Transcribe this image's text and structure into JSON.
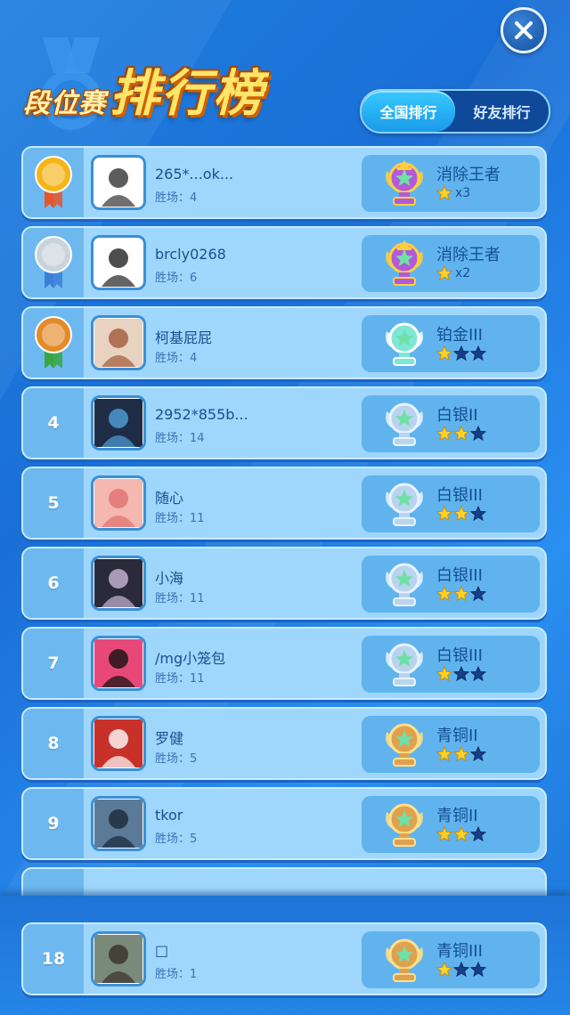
{
  "header": {
    "title_small": "段位赛",
    "title_big": "排行榜"
  },
  "tabs": [
    {
      "label": "全国排行",
      "active": true
    },
    {
      "label": "好友排行",
      "active": false
    }
  ],
  "wins_label": "胜场：",
  "rows": [
    {
      "rank": "1",
      "medal": "gold",
      "name": "265*...ok...",
      "wins": "4",
      "tier": "消除王者",
      "badge": "king",
      "star_count": "x3",
      "stars_filled": 1,
      "stars_total": 1
    },
    {
      "rank": "2",
      "medal": "silver",
      "name": "brcly0268",
      "wins": "6",
      "tier": "消除王者",
      "badge": "king",
      "star_count": "x2",
      "stars_filled": 1,
      "stars_total": 1
    },
    {
      "rank": "3",
      "medal": "bronze",
      "name": "柯基屁屁",
      "wins": "4",
      "tier": "铂金III",
      "badge": "platinum",
      "star_count": "",
      "stars_filled": 1,
      "stars_total": 3
    },
    {
      "rank": "4",
      "medal": "",
      "name": "2952*855b...",
      "wins": "14",
      "tier": "白银II",
      "badge": "silver",
      "star_count": "",
      "stars_filled": 2,
      "stars_total": 3
    },
    {
      "rank": "5",
      "medal": "",
      "name": "随心",
      "wins": "11",
      "tier": "白银III",
      "badge": "silver",
      "star_count": "",
      "stars_filled": 2,
      "stars_total": 3
    },
    {
      "rank": "6",
      "medal": "",
      "name": "小海",
      "wins": "11",
      "tier": "白银III",
      "badge": "silver",
      "star_count": "",
      "stars_filled": 2,
      "stars_total": 3
    },
    {
      "rank": "7",
      "medal": "",
      "name": "/mg小笼包",
      "wins": "11",
      "tier": "白银III",
      "badge": "silver",
      "star_count": "",
      "stars_filled": 1,
      "stars_total": 3
    },
    {
      "rank": "8",
      "medal": "",
      "name": "罗健",
      "wins": "5",
      "tier": "青铜II",
      "badge": "bronze",
      "star_count": "",
      "stars_filled": 2,
      "stars_total": 3
    },
    {
      "rank": "9",
      "medal": "",
      "name": "tkor",
      "wins": "5",
      "tier": "青铜II",
      "badge": "bronze",
      "star_count": "",
      "stars_filled": 2,
      "stars_total": 3
    }
  ],
  "my_row": {
    "rank": "18",
    "name": "□",
    "wins": "1",
    "tier": "青铜III",
    "badge": "bronze",
    "star_count": "",
    "stars_filled": 1,
    "stars_total": 3
  },
  "colors": {
    "gold_star": "#ffd22a",
    "empty_star": "#163f86",
    "medal_gold": "#f4b41a",
    "medal_silver": "#c9d3dc",
    "medal_bronze": "#e58a2a"
  },
  "icons": {
    "close": "close-icon",
    "star": "star-icon",
    "medal": "medal-icon",
    "king_badge": "king-trophy-icon",
    "platinum_badge": "platinum-trophy-icon",
    "silver_badge": "silver-trophy-icon",
    "bronze_badge": "bronze-trophy-icon"
  }
}
